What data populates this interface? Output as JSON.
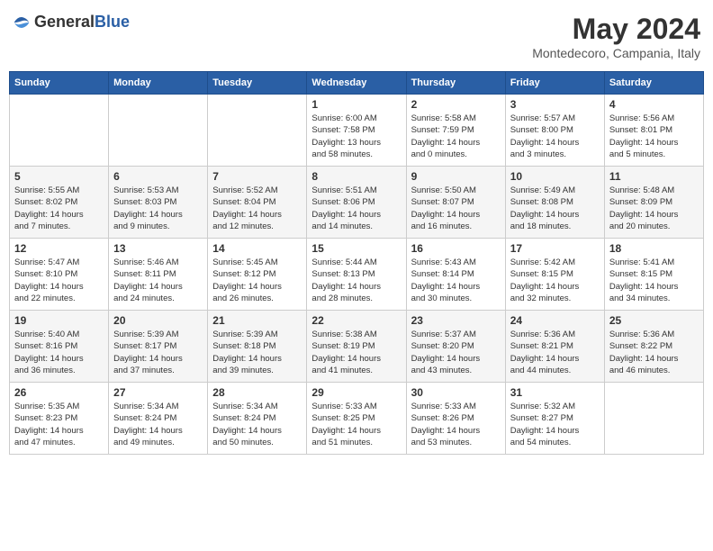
{
  "logo": {
    "general": "General",
    "blue": "Blue"
  },
  "title": "May 2024",
  "subtitle": "Montedecoro, Campania, Italy",
  "days": [
    "Sunday",
    "Monday",
    "Tuesday",
    "Wednesday",
    "Thursday",
    "Friday",
    "Saturday"
  ],
  "weeks": [
    [
      {
        "date": "",
        "info": ""
      },
      {
        "date": "",
        "info": ""
      },
      {
        "date": "",
        "info": ""
      },
      {
        "date": "1",
        "info": "Sunrise: 6:00 AM\nSunset: 7:58 PM\nDaylight: 13 hours\nand 58 minutes."
      },
      {
        "date": "2",
        "info": "Sunrise: 5:58 AM\nSunset: 7:59 PM\nDaylight: 14 hours\nand 0 minutes."
      },
      {
        "date": "3",
        "info": "Sunrise: 5:57 AM\nSunset: 8:00 PM\nDaylight: 14 hours\nand 3 minutes."
      },
      {
        "date": "4",
        "info": "Sunrise: 5:56 AM\nSunset: 8:01 PM\nDaylight: 14 hours\nand 5 minutes."
      }
    ],
    [
      {
        "date": "5",
        "info": "Sunrise: 5:55 AM\nSunset: 8:02 PM\nDaylight: 14 hours\nand 7 minutes."
      },
      {
        "date": "6",
        "info": "Sunrise: 5:53 AM\nSunset: 8:03 PM\nDaylight: 14 hours\nand 9 minutes."
      },
      {
        "date": "7",
        "info": "Sunrise: 5:52 AM\nSunset: 8:04 PM\nDaylight: 14 hours\nand 12 minutes."
      },
      {
        "date": "8",
        "info": "Sunrise: 5:51 AM\nSunset: 8:06 PM\nDaylight: 14 hours\nand 14 minutes."
      },
      {
        "date": "9",
        "info": "Sunrise: 5:50 AM\nSunset: 8:07 PM\nDaylight: 14 hours\nand 16 minutes."
      },
      {
        "date": "10",
        "info": "Sunrise: 5:49 AM\nSunset: 8:08 PM\nDaylight: 14 hours\nand 18 minutes."
      },
      {
        "date": "11",
        "info": "Sunrise: 5:48 AM\nSunset: 8:09 PM\nDaylight: 14 hours\nand 20 minutes."
      }
    ],
    [
      {
        "date": "12",
        "info": "Sunrise: 5:47 AM\nSunset: 8:10 PM\nDaylight: 14 hours\nand 22 minutes."
      },
      {
        "date": "13",
        "info": "Sunrise: 5:46 AM\nSunset: 8:11 PM\nDaylight: 14 hours\nand 24 minutes."
      },
      {
        "date": "14",
        "info": "Sunrise: 5:45 AM\nSunset: 8:12 PM\nDaylight: 14 hours\nand 26 minutes."
      },
      {
        "date": "15",
        "info": "Sunrise: 5:44 AM\nSunset: 8:13 PM\nDaylight: 14 hours\nand 28 minutes."
      },
      {
        "date": "16",
        "info": "Sunrise: 5:43 AM\nSunset: 8:14 PM\nDaylight: 14 hours\nand 30 minutes."
      },
      {
        "date": "17",
        "info": "Sunrise: 5:42 AM\nSunset: 8:15 PM\nDaylight: 14 hours\nand 32 minutes."
      },
      {
        "date": "18",
        "info": "Sunrise: 5:41 AM\nSunset: 8:15 PM\nDaylight: 14 hours\nand 34 minutes."
      }
    ],
    [
      {
        "date": "19",
        "info": "Sunrise: 5:40 AM\nSunset: 8:16 PM\nDaylight: 14 hours\nand 36 minutes."
      },
      {
        "date": "20",
        "info": "Sunrise: 5:39 AM\nSunset: 8:17 PM\nDaylight: 14 hours\nand 37 minutes."
      },
      {
        "date": "21",
        "info": "Sunrise: 5:39 AM\nSunset: 8:18 PM\nDaylight: 14 hours\nand 39 minutes."
      },
      {
        "date": "22",
        "info": "Sunrise: 5:38 AM\nSunset: 8:19 PM\nDaylight: 14 hours\nand 41 minutes."
      },
      {
        "date": "23",
        "info": "Sunrise: 5:37 AM\nSunset: 8:20 PM\nDaylight: 14 hours\nand 43 minutes."
      },
      {
        "date": "24",
        "info": "Sunrise: 5:36 AM\nSunset: 8:21 PM\nDaylight: 14 hours\nand 44 minutes."
      },
      {
        "date": "25",
        "info": "Sunrise: 5:36 AM\nSunset: 8:22 PM\nDaylight: 14 hours\nand 46 minutes."
      }
    ],
    [
      {
        "date": "26",
        "info": "Sunrise: 5:35 AM\nSunset: 8:23 PM\nDaylight: 14 hours\nand 47 minutes."
      },
      {
        "date": "27",
        "info": "Sunrise: 5:34 AM\nSunset: 8:24 PM\nDaylight: 14 hours\nand 49 minutes."
      },
      {
        "date": "28",
        "info": "Sunrise: 5:34 AM\nSunset: 8:24 PM\nDaylight: 14 hours\nand 50 minutes."
      },
      {
        "date": "29",
        "info": "Sunrise: 5:33 AM\nSunset: 8:25 PM\nDaylight: 14 hours\nand 51 minutes."
      },
      {
        "date": "30",
        "info": "Sunrise: 5:33 AM\nSunset: 8:26 PM\nDaylight: 14 hours\nand 53 minutes."
      },
      {
        "date": "31",
        "info": "Sunrise: 5:32 AM\nSunset: 8:27 PM\nDaylight: 14 hours\nand 54 minutes."
      },
      {
        "date": "",
        "info": ""
      }
    ]
  ]
}
